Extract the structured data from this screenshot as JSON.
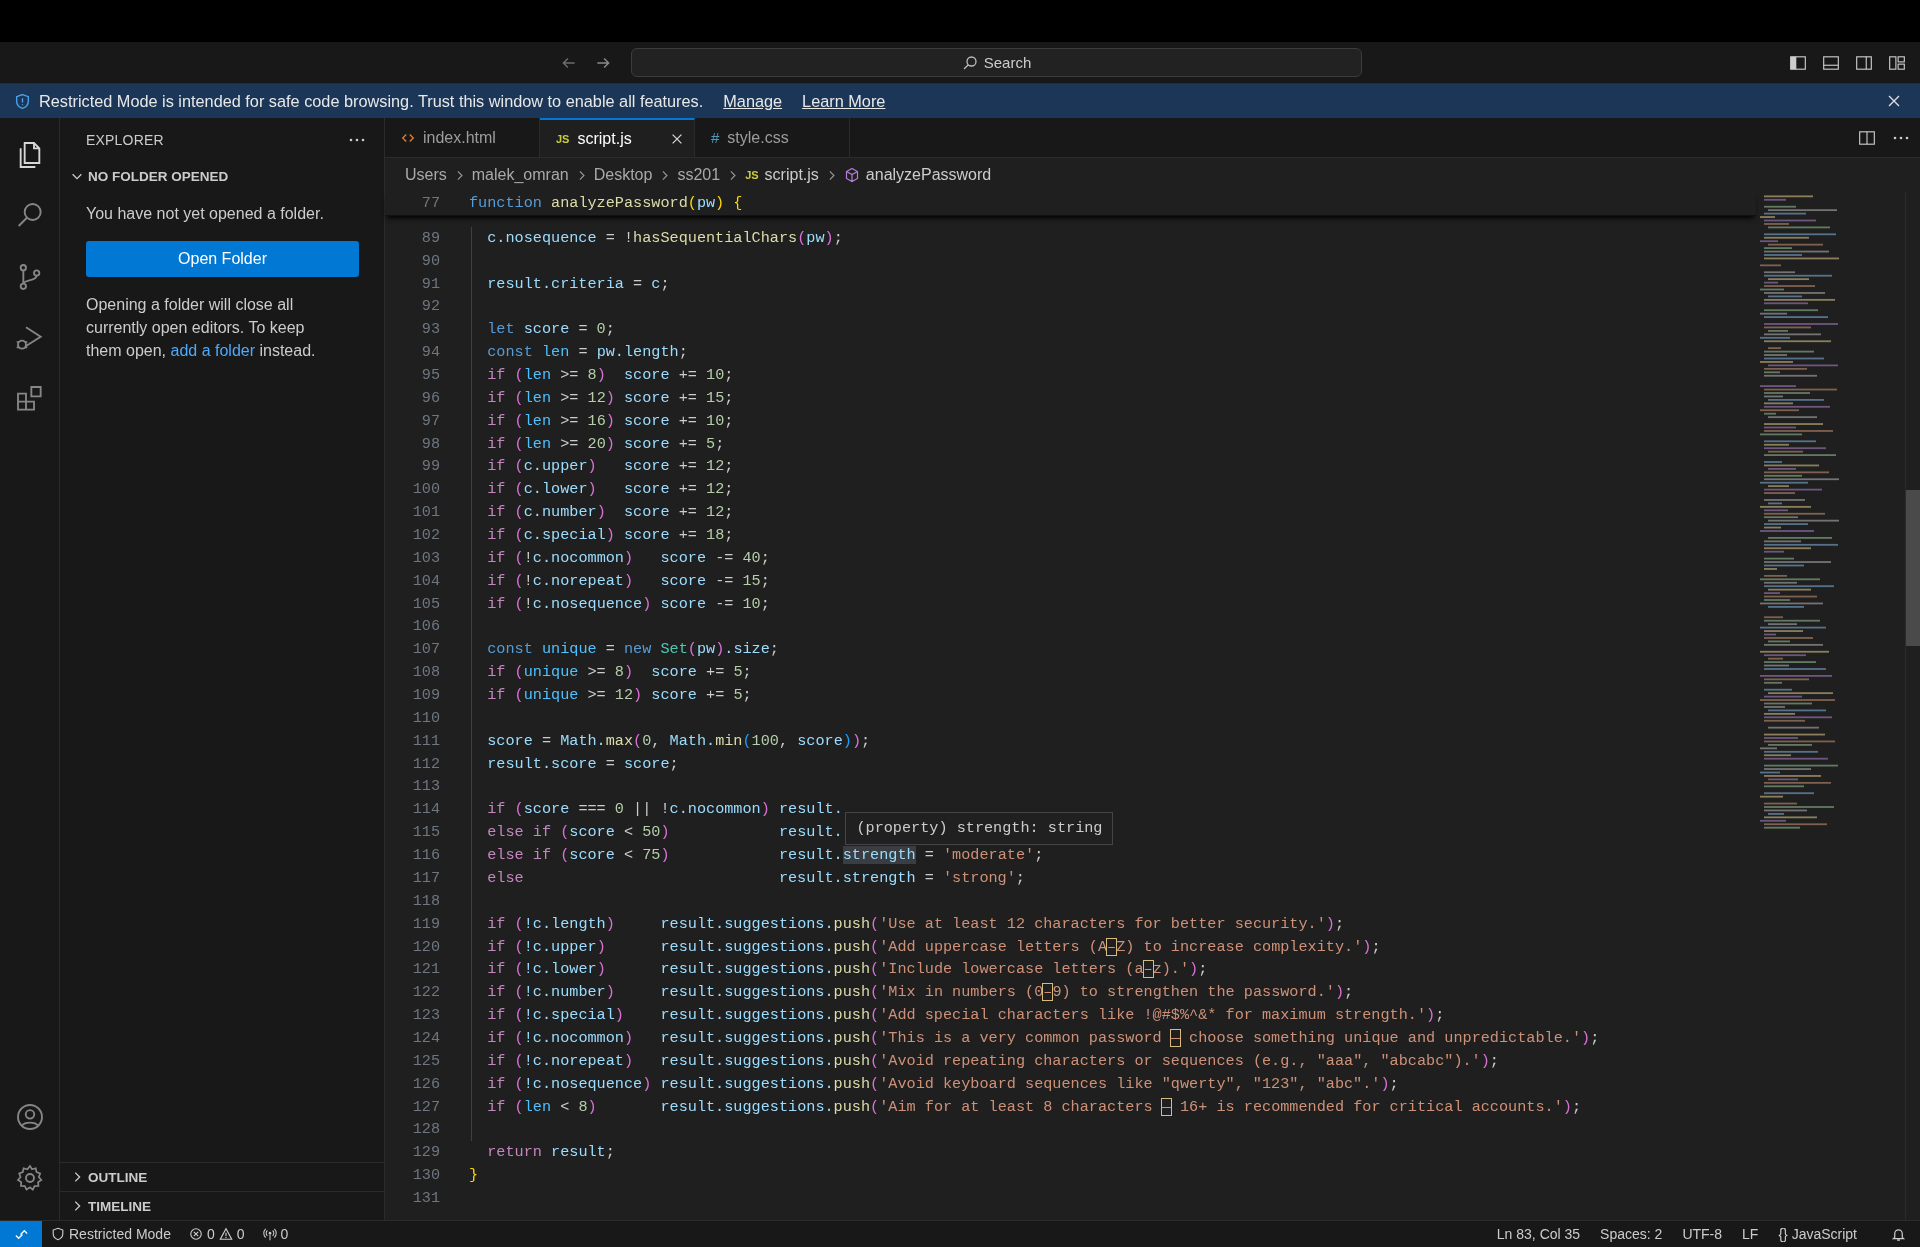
{
  "titlebar": {
    "search": {
      "placeholder": "Search"
    }
  },
  "banner": {
    "text": "Restricted Mode is intended for safe code browsing. Trust this window to enable all features.",
    "links": [
      "Manage",
      "Learn More"
    ]
  },
  "activity": [
    {
      "kind": "files",
      "selected": true
    },
    {
      "kind": "search",
      "selected": false
    },
    {
      "kind": "scm",
      "selected": false
    },
    {
      "kind": "debug",
      "selected": false
    },
    {
      "kind": "extensions",
      "selected": false
    }
  ],
  "activity_bottom": [
    {
      "kind": "account"
    },
    {
      "kind": "settings"
    }
  ],
  "sidebar": {
    "title": "EXPLORER",
    "section": {
      "title": "NO FOLDER OPENED",
      "expanded": true
    },
    "message": "You have not yet opened a folder.",
    "button": "Open Folder",
    "note_before": "Opening a folder will close all currently open editors. To keep them open,",
    "note_link": "add a folder",
    "note_after": "instead.",
    "bottom_sections": [
      {
        "title": "OUTLINE",
        "expanded": false
      },
      {
        "title": "TIMELINE",
        "expanded": false
      }
    ]
  },
  "tabs": [
    {
      "label": "index.html",
      "kind": "html",
      "selected": false
    },
    {
      "label": "script.js",
      "kind": "js",
      "badge": "JS",
      "selected": true
    },
    {
      "label": "style.css",
      "kind": "css",
      "badge": "#",
      "selected": false
    }
  ],
  "breadcrumb": [
    {
      "label": "Users",
      "kind": "folder"
    },
    {
      "label": "malek_omran",
      "kind": "folder"
    },
    {
      "label": "Desktop",
      "kind": "folder"
    },
    {
      "label": "ss201",
      "kind": "folder"
    },
    {
      "label": "script.js",
      "kind": "file",
      "badge": "JS"
    },
    {
      "label": "analyzePassword",
      "kind": "symbol"
    }
  ],
  "sticky": {
    "n": "77",
    "tokens": [
      {
        "t": "function",
        "kind": "k"
      },
      {
        "t": " analyzePassword",
        "kind": "f"
      },
      {
        "t": "(",
        "kind": "b1"
      },
      {
        "t": "pw",
        "kind": "v"
      },
      {
        "t": ")",
        "kind": "b1"
      },
      {
        "t": " {",
        "kind": "b1"
      }
    ]
  },
  "lines": [
    {
      "n": "89",
      "tokens": [
        {
          "t": "  c.nosequence",
          "kind": "v"
        },
        {
          "t": " = !",
          "kind": "p"
        },
        {
          "t": "hasSequentialChars",
          "kind": "f"
        },
        {
          "t": "(",
          "kind": "b2"
        },
        {
          "t": "pw",
          "kind": "v"
        },
        {
          "t": ")",
          "kind": "b2"
        },
        {
          "t": ";",
          "kind": "p"
        }
      ]
    },
    {
      "n": "90"
    },
    {
      "n": "91",
      "tokens": [
        {
          "t": "  result.criteria",
          "kind": "v"
        },
        {
          "t": " = ",
          "kind": "p"
        },
        {
          "t": "c",
          "kind": "v"
        },
        {
          "t": ";",
          "kind": "p"
        }
      ]
    },
    {
      "n": "92"
    },
    {
      "n": "93",
      "tokens": [
        {
          "t": "  let",
          "kind": "k"
        },
        {
          "t": " score",
          "kind": "v"
        },
        {
          "t": " = ",
          "kind": "p"
        },
        {
          "t": "0",
          "kind": "n"
        },
        {
          "t": ";",
          "kind": "p"
        }
      ]
    },
    {
      "n": "94",
      "tokens": [
        {
          "t": "  const",
          "kind": "k"
        },
        {
          "t": " len",
          "kind": "c"
        },
        {
          "t": " = ",
          "kind": "p"
        },
        {
          "t": "pw.length",
          "kind": "v"
        },
        {
          "t": ";",
          "kind": "p"
        }
      ]
    },
    {
      "n": "95",
      "tokens": [
        {
          "t": "  if",
          "kind": "x"
        },
        {
          "t": " (",
          "kind": "b2"
        },
        {
          "t": "len",
          "kind": "c"
        },
        {
          "t": " >= ",
          "kind": "p"
        },
        {
          "t": "8",
          "kind": "n"
        },
        {
          "t": ")",
          "kind": "b2"
        },
        {
          "t": "  score",
          "kind": "v"
        },
        {
          "t": " += ",
          "kind": "p"
        },
        {
          "t": "10",
          "kind": "n"
        },
        {
          "t": ";",
          "kind": "p"
        }
      ]
    },
    {
      "n": "96",
      "tokens": [
        {
          "t": "  if",
          "kind": "x"
        },
        {
          "t": " (",
          "kind": "b2"
        },
        {
          "t": "len",
          "kind": "c"
        },
        {
          "t": " >= ",
          "kind": "p"
        },
        {
          "t": "12",
          "kind": "n"
        },
        {
          "t": ")",
          "kind": "b2"
        },
        {
          "t": " score",
          "kind": "v"
        },
        {
          "t": " += ",
          "kind": "p"
        },
        {
          "t": "15",
          "kind": "n"
        },
        {
          "t": ";",
          "kind": "p"
        }
      ]
    },
    {
      "n": "97",
      "tokens": [
        {
          "t": "  if",
          "kind": "x"
        },
        {
          "t": " (",
          "kind": "b2"
        },
        {
          "t": "len",
          "kind": "c"
        },
        {
          "t": " >= ",
          "kind": "p"
        },
        {
          "t": "16",
          "kind": "n"
        },
        {
          "t": ")",
          "kind": "b2"
        },
        {
          "t": " score",
          "kind": "v"
        },
        {
          "t": " += ",
          "kind": "p"
        },
        {
          "t": "10",
          "kind": "n"
        },
        {
          "t": ";",
          "kind": "p"
        }
      ]
    },
    {
      "n": "98",
      "tokens": [
        {
          "t": "  if",
          "kind": "x"
        },
        {
          "t": " (",
          "kind": "b2"
        },
        {
          "t": "len",
          "kind": "c"
        },
        {
          "t": " >= ",
          "kind": "p"
        },
        {
          "t": "20",
          "kind": "n"
        },
        {
          "t": ")",
          "kind": "b2"
        },
        {
          "t": " score",
          "kind": "v"
        },
        {
          "t": " += ",
          "kind": "p"
        },
        {
          "t": "5",
          "kind": "n"
        },
        {
          "t": ";",
          "kind": "p"
        }
      ]
    },
    {
      "n": "99",
      "tokens": [
        {
          "t": "  if",
          "kind": "x"
        },
        {
          "t": " (",
          "kind": "b2"
        },
        {
          "t": "c.upper",
          "kind": "v"
        },
        {
          "t": ")",
          "kind": "b2"
        },
        {
          "t": "   score",
          "kind": "v"
        },
        {
          "t": " += ",
          "kind": "p"
        },
        {
          "t": "12",
          "kind": "n"
        },
        {
          "t": ";",
          "kind": "p"
        }
      ]
    },
    {
      "n": "100",
      "tokens": [
        {
          "t": "  if",
          "kind": "x"
        },
        {
          "t": " (",
          "kind": "b2"
        },
        {
          "t": "c.lower",
          "kind": "v"
        },
        {
          "t": ")",
          "kind": "b2"
        },
        {
          "t": "   score",
          "kind": "v"
        },
        {
          "t": " += ",
          "kind": "p"
        },
        {
          "t": "12",
          "kind": "n"
        },
        {
          "t": ";",
          "kind": "p"
        }
      ]
    },
    {
      "n": "101",
      "tokens": [
        {
          "t": "  if",
          "kind": "x"
        },
        {
          "t": " (",
          "kind": "b2"
        },
        {
          "t": "c.number",
          "kind": "v"
        },
        {
          "t": ")",
          "kind": "b2"
        },
        {
          "t": "  score",
          "kind": "v"
        },
        {
          "t": " += ",
          "kind": "p"
        },
        {
          "t": "12",
          "kind": "n"
        },
        {
          "t": ";",
          "kind": "p"
        }
      ]
    },
    {
      "n": "102",
      "tokens": [
        {
          "t": "  if",
          "kind": "x"
        },
        {
          "t": " (",
          "kind": "b2"
        },
        {
          "t": "c.special",
          "kind": "v"
        },
        {
          "t": ")",
          "kind": "b2"
        },
        {
          "t": " score",
          "kind": "v"
        },
        {
          "t": " += ",
          "kind": "p"
        },
        {
          "t": "18",
          "kind": "n"
        },
        {
          "t": ";",
          "kind": "p"
        }
      ]
    },
    {
      "n": "103",
      "tokens": [
        {
          "t": "  if",
          "kind": "x"
        },
        {
          "t": " (",
          "kind": "b2"
        },
        {
          "t": "!",
          "kind": "p"
        },
        {
          "t": "c.nocommon",
          "kind": "v"
        },
        {
          "t": ")",
          "kind": "b2"
        },
        {
          "t": "   score",
          "kind": "v"
        },
        {
          "t": " -= ",
          "kind": "p"
        },
        {
          "t": "40",
          "kind": "n"
        },
        {
          "t": ";",
          "kind": "p"
        }
      ]
    },
    {
      "n": "104",
      "tokens": [
        {
          "t": "  if",
          "kind": "x"
        },
        {
          "t": " (",
          "kind": "b2"
        },
        {
          "t": "!",
          "kind": "p"
        },
        {
          "t": "c.norepeat",
          "kind": "v"
        },
        {
          "t": ")",
          "kind": "b2"
        },
        {
          "t": "   score",
          "kind": "v"
        },
        {
          "t": " -= ",
          "kind": "p"
        },
        {
          "t": "15",
          "kind": "n"
        },
        {
          "t": ";",
          "kind": "p"
        }
      ]
    },
    {
      "n": "105",
      "tokens": [
        {
          "t": "  if",
          "kind": "x"
        },
        {
          "t": " (",
          "kind": "b2"
        },
        {
          "t": "!",
          "kind": "p"
        },
        {
          "t": "c.nosequence",
          "kind": "v"
        },
        {
          "t": ")",
          "kind": "b2"
        },
        {
          "t": " score",
          "kind": "v"
        },
        {
          "t": " -= ",
          "kind": "p"
        },
        {
          "t": "10",
          "kind": "n"
        },
        {
          "t": ";",
          "kind": "p"
        }
      ]
    },
    {
      "n": "106"
    },
    {
      "n": "107",
      "tokens": [
        {
          "t": "  const",
          "kind": "k"
        },
        {
          "t": " unique",
          "kind": "c"
        },
        {
          "t": " = ",
          "kind": "p"
        },
        {
          "t": "new",
          "kind": "k"
        },
        {
          "t": " Set",
          "kind": "y"
        },
        {
          "t": "(",
          "kind": "b2"
        },
        {
          "t": "pw",
          "kind": "v"
        },
        {
          "t": ")",
          "kind": "b2"
        },
        {
          "t": ".size",
          "kind": "v"
        },
        {
          "t": ";",
          "kind": "p"
        }
      ]
    },
    {
      "n": "108",
      "tokens": [
        {
          "t": "  if",
          "kind": "x"
        },
        {
          "t": " (",
          "kind": "b2"
        },
        {
          "t": "unique",
          "kind": "c"
        },
        {
          "t": " >= ",
          "kind": "p"
        },
        {
          "t": "8",
          "kind": "n"
        },
        {
          "t": ")",
          "kind": "b2"
        },
        {
          "t": "  score",
          "kind": "v"
        },
        {
          "t": " += ",
          "kind": "p"
        },
        {
          "t": "5",
          "kind": "n"
        },
        {
          "t": ";",
          "kind": "p"
        }
      ]
    },
    {
      "n": "109",
      "tokens": [
        {
          "t": "  if",
          "kind": "x"
        },
        {
          "t": " (",
          "kind": "b2"
        },
        {
          "t": "unique",
          "kind": "c"
        },
        {
          "t": " >= ",
          "kind": "p"
        },
        {
          "t": "12",
          "kind": "n"
        },
        {
          "t": ")",
          "kind": "b2"
        },
        {
          "t": " score",
          "kind": "v"
        },
        {
          "t": " += ",
          "kind": "p"
        },
        {
          "t": "5",
          "kind": "n"
        },
        {
          "t": ";",
          "kind": "p"
        }
      ]
    },
    {
      "n": "110"
    },
    {
      "n": "111",
      "tokens": [
        {
          "t": "  score",
          "kind": "v"
        },
        {
          "t": " = ",
          "kind": "p"
        },
        {
          "t": "Math.",
          "kind": "v"
        },
        {
          "t": "max",
          "kind": "f"
        },
        {
          "t": "(",
          "kind": "b2"
        },
        {
          "t": "0",
          "kind": "n"
        },
        {
          "t": ", ",
          "kind": "p"
        },
        {
          "t": "Math.",
          "kind": "v"
        },
        {
          "t": "min",
          "kind": "f"
        },
        {
          "t": "(",
          "kind": "b3"
        },
        {
          "t": "100",
          "kind": "n"
        },
        {
          "t": ", ",
          "kind": "p"
        },
        {
          "t": "score",
          "kind": "v"
        },
        {
          "t": ")",
          "kind": "b3"
        },
        {
          "t": ")",
          "kind": "b2"
        },
        {
          "t": ";",
          "kind": "p"
        }
      ]
    },
    {
      "n": "112",
      "tokens": [
        {
          "t": "  result.score",
          "kind": "v"
        },
        {
          "t": " = ",
          "kind": "p"
        },
        {
          "t": "score",
          "kind": "v"
        },
        {
          "t": ";",
          "kind": "p"
        }
      ]
    },
    {
      "n": "113"
    },
    {
      "n": "114",
      "hover": "(property) strength: string",
      "tokens": [
        {
          "t": "  if",
          "kind": "x"
        },
        {
          "t": " (",
          "kind": "b2"
        },
        {
          "t": "score",
          "kind": "v"
        },
        {
          "t": " === ",
          "kind": "p"
        },
        {
          "t": "0",
          "kind": "n"
        },
        {
          "t": " || !",
          "kind": "p"
        },
        {
          "t": "c.nocommon",
          "kind": "v"
        },
        {
          "t": ")",
          "kind": "b2"
        },
        {
          "t": " result.",
          "kind": "v"
        }
      ]
    },
    {
      "n": "115",
      "tokens": [
        {
          "t": "  else if",
          "kind": "x"
        },
        {
          "t": " (",
          "kind": "b2"
        },
        {
          "t": "score",
          "kind": "v"
        },
        {
          "t": " < ",
          "kind": "p"
        },
        {
          "t": "50",
          "kind": "n"
        },
        {
          "t": ")",
          "kind": "b2"
        },
        {
          "t": "            result.",
          "kind": "v"
        }
      ]
    },
    {
      "n": "116",
      "tokens": [
        {
          "t": "  else if",
          "kind": "x"
        },
        {
          "t": " (",
          "kind": "b2"
        },
        {
          "t": "score",
          "kind": "v"
        },
        {
          "t": " < ",
          "kind": "p"
        },
        {
          "t": "75",
          "kind": "n"
        },
        {
          "t": ")",
          "kind": "b2"
        },
        {
          "t": "            result.",
          "kind": "v"
        },
        {
          "t": "strength",
          "kind": "h"
        },
        {
          "t": " = ",
          "kind": "p"
        },
        {
          "t": "'moderate'",
          "kind": "s"
        },
        {
          "t": ";",
          "kind": "p"
        }
      ]
    },
    {
      "n": "117",
      "tokens": [
        {
          "t": "  else",
          "kind": "x"
        },
        {
          "t": "                            result.strength",
          "kind": "v"
        },
        {
          "t": " = ",
          "kind": "p"
        },
        {
          "t": "'strong'",
          "kind": "s"
        },
        {
          "t": ";",
          "kind": "p"
        }
      ]
    },
    {
      "n": "118"
    },
    {
      "n": "119",
      "tokens": [
        {
          "t": "  if",
          "kind": "x"
        },
        {
          "t": " (",
          "kind": "b2"
        },
        {
          "t": "!c.length",
          "kind": "v"
        },
        {
          "t": ")",
          "kind": "b2"
        },
        {
          "t": "     result.suggestions.",
          "kind": "v"
        },
        {
          "t": "push",
          "kind": "f"
        },
        {
          "t": "(",
          "kind": "b2"
        },
        {
          "t": "'Use at least 12 characters for better security.'",
          "kind": "s"
        },
        {
          "t": ")",
          "kind": "b2"
        },
        {
          "t": ";",
          "kind": "p"
        }
      ]
    },
    {
      "n": "120",
      "tokens": [
        {
          "t": "  if",
          "kind": "x"
        },
        {
          "t": " (",
          "kind": "b2"
        },
        {
          "t": "!c.upper",
          "kind": "v"
        },
        {
          "t": ")",
          "kind": "b2"
        },
        {
          "t": "      result.suggestions.",
          "kind": "v"
        },
        {
          "t": "push",
          "kind": "f"
        },
        {
          "t": "(",
          "kind": "b2"
        },
        {
          "t": "'Add uppercase letters (A",
          "kind": "s"
        },
        {
          "t": "–",
          "kind": "u"
        },
        {
          "t": "Z) to increase complexity.'",
          "kind": "s"
        },
        {
          "t": ")",
          "kind": "b2"
        },
        {
          "t": ";",
          "kind": "p"
        }
      ]
    },
    {
      "n": "121",
      "tokens": [
        {
          "t": "  if",
          "kind": "x"
        },
        {
          "t": " (",
          "kind": "b2"
        },
        {
          "t": "!c.lower",
          "kind": "v"
        },
        {
          "t": ")",
          "kind": "b2"
        },
        {
          "t": "      result.suggestions.",
          "kind": "v"
        },
        {
          "t": "push",
          "kind": "f"
        },
        {
          "t": "(",
          "kind": "b2"
        },
        {
          "t": "'Include lowercase letters (a",
          "kind": "s"
        },
        {
          "t": "–",
          "kind": "u"
        },
        {
          "t": "z).'",
          "kind": "s"
        },
        {
          "t": ")",
          "kind": "b2"
        },
        {
          "t": ";",
          "kind": "p"
        }
      ]
    },
    {
      "n": "122",
      "tokens": [
        {
          "t": "  if",
          "kind": "x"
        },
        {
          "t": " (",
          "kind": "b2"
        },
        {
          "t": "!c.number",
          "kind": "v"
        },
        {
          "t": ")",
          "kind": "b2"
        },
        {
          "t": "     result.suggestions.",
          "kind": "v"
        },
        {
          "t": "push",
          "kind": "f"
        },
        {
          "t": "(",
          "kind": "b2"
        },
        {
          "t": "'Mix in numbers (0",
          "kind": "s"
        },
        {
          "t": "–",
          "kind": "u"
        },
        {
          "t": "9) to strengthen the password.'",
          "kind": "s"
        },
        {
          "t": ")",
          "kind": "b2"
        },
        {
          "t": ";",
          "kind": "p"
        }
      ]
    },
    {
      "n": "123",
      "tokens": [
        {
          "t": "  if",
          "kind": "x"
        },
        {
          "t": " (",
          "kind": "b2"
        },
        {
          "t": "!c.special",
          "kind": "v"
        },
        {
          "t": ")",
          "kind": "b2"
        },
        {
          "t": "    result.suggestions.",
          "kind": "v"
        },
        {
          "t": "push",
          "kind": "f"
        },
        {
          "t": "(",
          "kind": "b2"
        },
        {
          "t": "'Add special characters like !@#$%^&* for maximum strength.'",
          "kind": "s"
        },
        {
          "t": ")",
          "kind": "b2"
        },
        {
          "t": ";",
          "kind": "p"
        }
      ]
    },
    {
      "n": "124",
      "tokens": [
        {
          "t": "  if",
          "kind": "x"
        },
        {
          "t": " (",
          "kind": "b2"
        },
        {
          "t": "!c.nocommon",
          "kind": "v"
        },
        {
          "t": ")",
          "kind": "b2"
        },
        {
          "t": "   result.suggestions.",
          "kind": "v"
        },
        {
          "t": "push",
          "kind": "f"
        },
        {
          "t": "(",
          "kind": "b2"
        },
        {
          "t": "'This is a very common password ",
          "kind": "s"
        },
        {
          "t": "—",
          "kind": "u"
        },
        {
          "t": " choose something unique and unpredictable.'",
          "kind": "s"
        },
        {
          "t": ")",
          "kind": "b2"
        },
        {
          "t": ";",
          "kind": "p"
        }
      ]
    },
    {
      "n": "125",
      "tokens": [
        {
          "t": "  if",
          "kind": "x"
        },
        {
          "t": " (",
          "kind": "b2"
        },
        {
          "t": "!c.norepeat",
          "kind": "v"
        },
        {
          "t": ")",
          "kind": "b2"
        },
        {
          "t": "   result.suggestions.",
          "kind": "v"
        },
        {
          "t": "push",
          "kind": "f"
        },
        {
          "t": "(",
          "kind": "b2"
        },
        {
          "t": "'Avoid repeating characters or sequences (e.g., \"aaa\", \"abcabc\").'",
          "kind": "s"
        },
        {
          "t": ")",
          "kind": "b2"
        },
        {
          "t": ";",
          "kind": "p"
        }
      ]
    },
    {
      "n": "126",
      "tokens": [
        {
          "t": "  if",
          "kind": "x"
        },
        {
          "t": " (",
          "kind": "b2"
        },
        {
          "t": "!c.nosequence",
          "kind": "v"
        },
        {
          "t": ")",
          "kind": "b2"
        },
        {
          "t": " result.suggestions.",
          "kind": "v"
        },
        {
          "t": "push",
          "kind": "f"
        },
        {
          "t": "(",
          "kind": "b2"
        },
        {
          "t": "'Avoid keyboard sequences like \"qwerty\", \"123\", \"abc\".'",
          "kind": "s"
        },
        {
          "t": ")",
          "kind": "b2"
        },
        {
          "t": ";",
          "kind": "p"
        }
      ]
    },
    {
      "n": "127",
      "tokens": [
        {
          "t": "  if",
          "kind": "x"
        },
        {
          "t": " (",
          "kind": "b2"
        },
        {
          "t": "len",
          "kind": "c"
        },
        {
          "t": " < ",
          "kind": "p"
        },
        {
          "t": "8",
          "kind": "n"
        },
        {
          "t": ")",
          "kind": "b2"
        },
        {
          "t": "       result.suggestions.",
          "kind": "v"
        },
        {
          "t": "push",
          "kind": "f"
        },
        {
          "t": "(",
          "kind": "b2"
        },
        {
          "t": "'Aim for at least 8 characters ",
          "kind": "s"
        },
        {
          "t": "—",
          "kind": "u"
        },
        {
          "t": " 16+ is recommended for critical accounts.'",
          "kind": "s"
        },
        {
          "t": ")",
          "kind": "b2"
        },
        {
          "t": ";",
          "kind": "p"
        }
      ]
    },
    {
      "n": "128"
    },
    {
      "n": "129",
      "tokens": [
        {
          "t": "  return",
          "kind": "x"
        },
        {
          "t": " result",
          "kind": "v"
        },
        {
          "t": ";",
          "kind": "p"
        }
      ]
    },
    {
      "n": "130",
      "tokens": [
        {
          "t": "}",
          "kind": "b1"
        }
      ]
    },
    {
      "n": "131"
    }
  ],
  "status_bar": {
    "mode": "Restricted Mode",
    "errors": "0",
    "warnings": "0",
    "ports": "0",
    "items": [
      "Ln 83, Col 35",
      "Spaces: 2",
      "UTF-8",
      "LF",
      "{} JavaScript"
    ]
  }
}
